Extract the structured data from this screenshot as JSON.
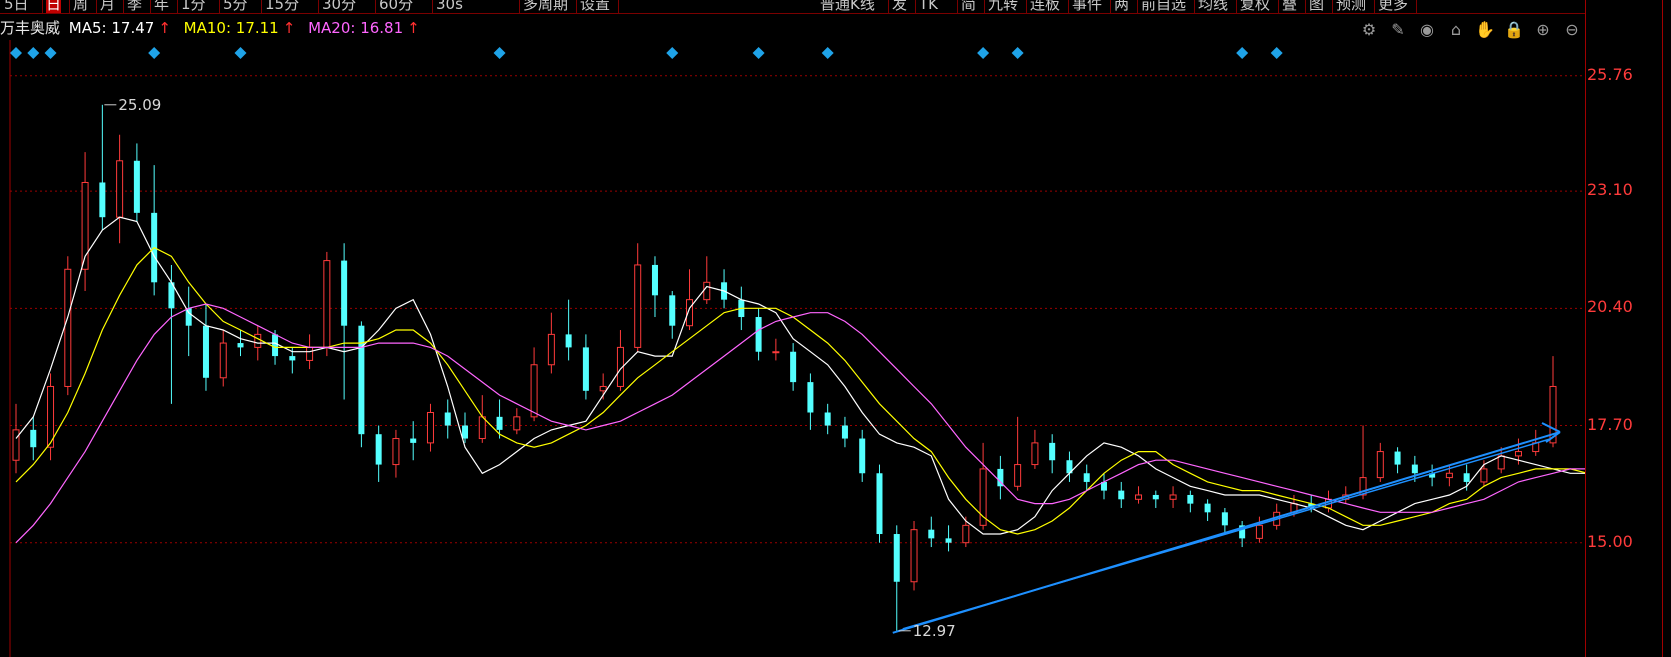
{
  "toolbar": {
    "items": [
      {
        "label": "5日"
      },
      {
        "label": "日",
        "active": true
      },
      {
        "label": "周"
      },
      {
        "label": "月"
      },
      {
        "label": "季"
      },
      {
        "label": "年"
      },
      {
        "label": "1分"
      },
      {
        "label": "5分"
      },
      {
        "label": "15分"
      },
      {
        "label": "30分"
      },
      {
        "label": "60分"
      },
      {
        "label": "30s"
      },
      {
        "label": "多周期"
      },
      {
        "label": "设置"
      },
      {
        "label": "普通K线"
      },
      {
        "label": "发"
      },
      {
        "label": "TK"
      },
      {
        "label": "简"
      },
      {
        "label": "九转"
      },
      {
        "label": "连板"
      },
      {
        "label": "事件"
      },
      {
        "label": "两"
      },
      {
        "label": "前自选"
      },
      {
        "label": "均线"
      },
      {
        "label": "复权"
      },
      {
        "label": "叠"
      },
      {
        "label": "图"
      },
      {
        "label": "预测"
      },
      {
        "label": "更多"
      }
    ]
  },
  "info": {
    "stock_name": "万丰奥威",
    "ma5_label": "MA5: 17.47",
    "ma10_label": "MA10: 17.11",
    "ma20_label": "MA20: 16.81",
    "arrow": "↑"
  },
  "tools": [
    {
      "name": "settings-icon",
      "glyph": "⚙"
    },
    {
      "name": "draw-pen-icon",
      "glyph": "✎"
    },
    {
      "name": "eye-icon",
      "glyph": "◉"
    },
    {
      "name": "stamp-icon",
      "glyph": "⌂"
    },
    {
      "name": "hand-icon",
      "glyph": "✋"
    },
    {
      "name": "lock-icon",
      "glyph": "🔒"
    },
    {
      "name": "zoom-in-icon",
      "glyph": "⊕"
    },
    {
      "name": "zoom-out-icon",
      "glyph": "⊖"
    }
  ],
  "colors": {
    "up": "#ff3b3b",
    "down": "#54ffff",
    "ma5": "#ffffff",
    "ma10": "#ffff00",
    "ma20": "#ff66ff",
    "trendline": "#1e90ff",
    "grid": "#9a0000",
    "event_marker": "#1fa3e8"
  },
  "chart_data": {
    "type": "candlestick",
    "y_ticks": [
      "25.76",
      "23.10",
      "20.40",
      "17.70",
      "15.00"
    ],
    "ylim": [
      12.5,
      26.2
    ],
    "high_annotation": "25.09",
    "low_annotation": "12.97",
    "ma_series": [
      {
        "name": "MA5",
        "color": "#ffffff",
        "values": [
          17.4,
          17.9,
          19.0,
          20.2,
          21.6,
          22.2,
          22.5,
          22.4,
          21.6,
          21.0,
          20.3,
          20.0,
          19.9,
          19.7,
          19.6,
          19.6,
          19.4,
          19.4,
          19.5,
          19.4,
          19.5,
          19.9,
          20.4,
          20.6,
          19.8,
          18.6,
          17.2,
          16.6,
          16.8,
          17.1,
          17.4,
          17.6,
          17.7,
          17.8,
          18.4,
          19.0,
          19.4,
          19.3,
          19.3,
          20.4,
          20.9,
          20.8,
          20.6,
          20.5,
          20.3,
          19.7,
          19.4,
          19.1,
          18.6,
          18.0,
          17.5,
          17.3,
          17.2,
          17.0,
          16.0,
          15.5,
          15.2,
          15.2,
          15.3,
          15.6,
          16.2,
          16.6,
          17.0,
          17.3,
          17.2,
          17.0,
          16.7,
          16.5,
          16.3,
          16.2,
          16.1,
          16.1,
          16.1,
          16.0,
          15.9,
          15.8,
          15.6,
          15.4,
          15.3,
          15.5,
          15.7,
          15.9,
          16.0,
          16.1,
          16.3,
          16.8,
          17.0,
          16.9,
          16.8,
          16.7,
          16.6,
          16.6,
          16.7,
          16.9,
          17.2,
          17.4,
          17.5
        ]
      },
      {
        "name": "MA10",
        "color": "#ffff00",
        "values": [
          16.4,
          16.8,
          17.3,
          18.0,
          18.9,
          19.9,
          20.7,
          21.4,
          21.8,
          21.6,
          21.0,
          20.5,
          20.1,
          19.9,
          19.7,
          19.5,
          19.5,
          19.5,
          19.5,
          19.6,
          19.6,
          19.7,
          19.9,
          19.9,
          19.6,
          19.1,
          18.5,
          17.9,
          17.5,
          17.3,
          17.2,
          17.3,
          17.5,
          17.7,
          18.0,
          18.4,
          18.8,
          19.1,
          19.4,
          19.7,
          20.0,
          20.3,
          20.4,
          20.4,
          20.4,
          20.2,
          19.9,
          19.6,
          19.2,
          18.7,
          18.2,
          17.8,
          17.4,
          17.1,
          16.5,
          16.0,
          15.6,
          15.3,
          15.2,
          15.3,
          15.5,
          15.8,
          16.2,
          16.6,
          16.9,
          17.1,
          17.1,
          16.8,
          16.6,
          16.4,
          16.3,
          16.2,
          16.2,
          16.1,
          16.0,
          15.9,
          15.8,
          15.6,
          15.4,
          15.4,
          15.5,
          15.6,
          15.7,
          15.9,
          16.0,
          16.3,
          16.5,
          16.6,
          16.7,
          16.7,
          16.7,
          16.6,
          16.6,
          16.7,
          16.9,
          17.0,
          17.1
        ]
      },
      {
        "name": "MA20",
        "color": "#ff66ff",
        "values": [
          15.0,
          15.4,
          15.9,
          16.5,
          17.1,
          17.8,
          18.5,
          19.2,
          19.8,
          20.2,
          20.4,
          20.5,
          20.4,
          20.2,
          20.0,
          19.8,
          19.6,
          19.5,
          19.5,
          19.5,
          19.5,
          19.6,
          19.6,
          19.6,
          19.5,
          19.3,
          19.0,
          18.7,
          18.4,
          18.2,
          18.0,
          17.8,
          17.7,
          17.6,
          17.7,
          17.8,
          18.0,
          18.2,
          18.4,
          18.7,
          19.0,
          19.3,
          19.6,
          19.9,
          20.1,
          20.2,
          20.3,
          20.3,
          20.1,
          19.8,
          19.4,
          19.0,
          18.6,
          18.2,
          17.7,
          17.2,
          16.8,
          16.4,
          16.0,
          15.9,
          15.9,
          16.0,
          16.2,
          16.4,
          16.6,
          16.8,
          16.9,
          16.9,
          16.8,
          16.7,
          16.6,
          16.5,
          16.4,
          16.3,
          16.2,
          16.1,
          16.0,
          15.9,
          15.8,
          15.7,
          15.7,
          15.7,
          15.7,
          15.8,
          15.9,
          16.0,
          16.2,
          16.4,
          16.5,
          16.6,
          16.7,
          16.7,
          16.7,
          16.7,
          16.8,
          16.8,
          16.8
        ]
      }
    ],
    "candles": [
      [
        16.9,
        17.6,
        18.2,
        16.6
      ],
      [
        17.6,
        17.2,
        17.9,
        16.9
      ],
      [
        17.2,
        18.6,
        18.9,
        16.9
      ],
      [
        18.6,
        21.3,
        21.6,
        18.4
      ],
      [
        21.3,
        23.3,
        24.0,
        20.8
      ],
      [
        23.3,
        22.5,
        25.09,
        22.2
      ],
      [
        22.5,
        23.8,
        24.4,
        21.9
      ],
      [
        23.8,
        22.6,
        24.2,
        22.4
      ],
      [
        22.6,
        21.0,
        23.7,
        20.7
      ],
      [
        21.0,
        20.4,
        21.4,
        18.2
      ],
      [
        20.4,
        20.0,
        20.9,
        19.3
      ],
      [
        20.0,
        18.8,
        20.5,
        18.5
      ],
      [
        18.8,
        19.6,
        19.9,
        18.6
      ],
      [
        19.6,
        19.5,
        19.9,
        19.3
      ],
      [
        19.5,
        19.8,
        20.0,
        19.2
      ],
      [
        19.8,
        19.3,
        19.9,
        19.1
      ],
      [
        19.3,
        19.2,
        19.5,
        18.9
      ],
      [
        19.2,
        19.5,
        19.8,
        19.0
      ],
      [
        19.5,
        21.5,
        21.7,
        19.3
      ],
      [
        21.5,
        20.0,
        21.9,
        18.3
      ],
      [
        20.0,
        17.5,
        20.1,
        17.2
      ],
      [
        17.5,
        16.8,
        17.7,
        16.4
      ],
      [
        16.8,
        17.4,
        17.6,
        16.5
      ],
      [
        17.4,
        17.3,
        17.8,
        16.9
      ],
      [
        17.3,
        18.0,
        18.2,
        17.1
      ],
      [
        18.0,
        17.7,
        18.3,
        17.4
      ],
      [
        17.7,
        17.4,
        18.0,
        17.3
      ],
      [
        17.4,
        17.9,
        18.4,
        17.3
      ],
      [
        17.9,
        17.6,
        18.3,
        17.4
      ],
      [
        17.6,
        17.9,
        18.1,
        17.5
      ],
      [
        17.9,
        19.1,
        19.5,
        17.8
      ],
      [
        19.1,
        19.8,
        20.3,
        18.9
      ],
      [
        19.8,
        19.5,
        20.6,
        19.2
      ],
      [
        19.5,
        18.5,
        19.8,
        18.3
      ],
      [
        18.5,
        18.6,
        18.9,
        18.3
      ],
      [
        18.6,
        19.5,
        19.9,
        18.5
      ],
      [
        19.5,
        21.4,
        21.9,
        19.4
      ],
      [
        21.4,
        20.7,
        21.6,
        20.2
      ],
      [
        20.7,
        20.0,
        20.8,
        19.7
      ],
      [
        20.0,
        20.6,
        21.3,
        19.9
      ],
      [
        20.6,
        21.0,
        21.6,
        20.5
      ],
      [
        21.0,
        20.6,
        21.3,
        20.4
      ],
      [
        20.6,
        20.2,
        20.9,
        19.9
      ],
      [
        20.2,
        19.4,
        20.4,
        19.2
      ],
      [
        19.4,
        19.4,
        19.7,
        19.2
      ],
      [
        19.4,
        18.7,
        19.6,
        18.5
      ],
      [
        18.7,
        18.0,
        18.9,
        17.6
      ],
      [
        18.0,
        17.7,
        18.2,
        17.5
      ],
      [
        17.7,
        17.4,
        17.9,
        17.2
      ],
      [
        17.4,
        16.6,
        17.6,
        16.4
      ],
      [
        16.6,
        15.2,
        16.8,
        15.0
      ],
      [
        15.2,
        14.1,
        15.4,
        12.97
      ],
      [
        14.1,
        15.3,
        15.5,
        13.9
      ],
      [
        15.3,
        15.1,
        15.6,
        14.9
      ],
      [
        15.1,
        15.0,
        15.4,
        14.8
      ],
      [
        15.0,
        15.4,
        15.6,
        14.9
      ],
      [
        15.4,
        16.7,
        17.3,
        15.3
      ],
      [
        16.7,
        16.3,
        17.0,
        16.0
      ],
      [
        16.3,
        16.8,
        17.9,
        16.2
      ],
      [
        16.8,
        17.3,
        17.6,
        16.7
      ],
      [
        17.3,
        16.9,
        17.5,
        16.6
      ],
      [
        16.9,
        16.6,
        17.1,
        16.4
      ],
      [
        16.6,
        16.4,
        16.8,
        16.2
      ],
      [
        16.4,
        16.2,
        16.6,
        16.0
      ],
      [
        16.2,
        16.0,
        16.4,
        15.8
      ],
      [
        16.0,
        16.1,
        16.3,
        15.9
      ],
      [
        16.1,
        16.0,
        16.2,
        15.8
      ],
      [
        16.0,
        16.1,
        16.3,
        15.8
      ],
      [
        16.1,
        15.9,
        16.2,
        15.7
      ],
      [
        15.9,
        15.7,
        16.0,
        15.5
      ],
      [
        15.7,
        15.4,
        15.8,
        15.2
      ],
      [
        15.4,
        15.1,
        15.5,
        14.9
      ],
      [
        15.1,
        15.4,
        15.6,
        15.0
      ],
      [
        15.4,
        15.7,
        15.9,
        15.3
      ],
      [
        15.7,
        15.9,
        16.1,
        15.6
      ],
      [
        15.9,
        15.8,
        16.1,
        15.7
      ],
      [
        15.8,
        16.0,
        16.2,
        15.7
      ],
      [
        16.0,
        16.1,
        16.3,
        15.9
      ],
      [
        16.1,
        16.5,
        17.7,
        16.0
      ],
      [
        16.5,
        17.1,
        17.3,
        16.4
      ],
      [
        17.1,
        16.8,
        17.2,
        16.6
      ],
      [
        16.8,
        16.6,
        17.0,
        16.4
      ],
      [
        16.6,
        16.5,
        16.8,
        16.3
      ],
      [
        16.5,
        16.6,
        16.8,
        16.3
      ],
      [
        16.6,
        16.4,
        16.8,
        16.2
      ],
      [
        16.4,
        16.7,
        16.9,
        16.3
      ],
      [
        16.7,
        17.0,
        17.2,
        16.6
      ],
      [
        17.0,
        17.1,
        17.4,
        16.8
      ],
      [
        17.1,
        17.3,
        17.6,
        17.0
      ],
      [
        17.3,
        18.6,
        19.3,
        17.2
      ]
    ],
    "trendline": {
      "from": [
        51,
        12.97
      ],
      "to": [
        89,
        17.55
      ]
    },
    "event_marker_indices": [
      0,
      1,
      2,
      8,
      13,
      28,
      38,
      43,
      47,
      56,
      58,
      71,
      73,
      95
    ]
  }
}
